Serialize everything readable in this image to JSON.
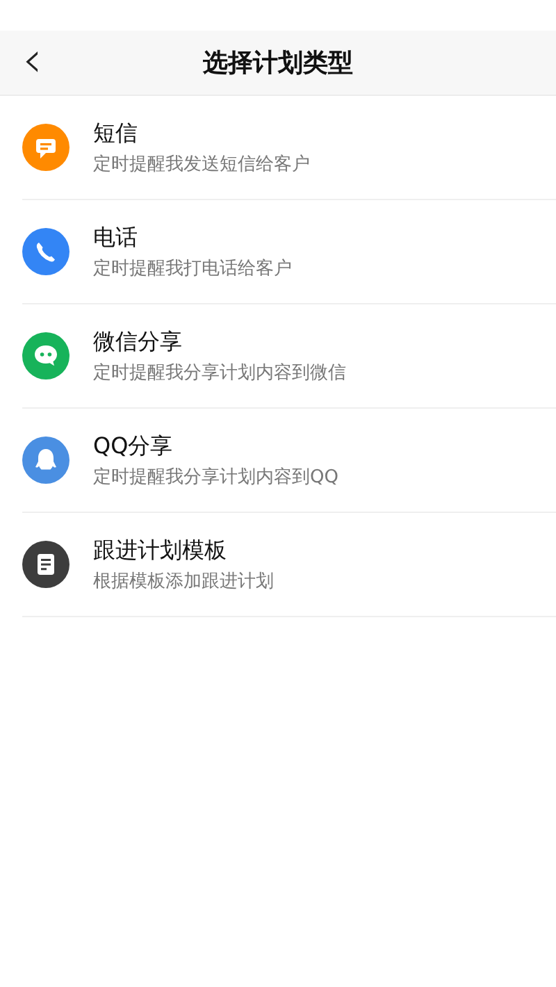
{
  "header": {
    "back": "‹",
    "title": "选择计划类型"
  },
  "items": [
    {
      "kind": "sms",
      "color": "#ff8a00",
      "title": "短信",
      "subtitle": "定时提醒我发送短信给客户"
    },
    {
      "kind": "phone",
      "color": "#3385f5",
      "title": "电话",
      "subtitle": "定时提醒我打电话给客户"
    },
    {
      "kind": "wechat",
      "color": "#17b35a",
      "title": "微信分享",
      "subtitle": "定时提醒我分享计划内容到微信"
    },
    {
      "kind": "qq",
      "color": "#4a8fe2",
      "title": "QQ分享",
      "subtitle": "定时提醒我分享计划内容到QQ"
    },
    {
      "kind": "template",
      "color": "#3d3d3d",
      "title": "跟进计划模板",
      "subtitle": "根据模板添加跟进计划"
    }
  ]
}
